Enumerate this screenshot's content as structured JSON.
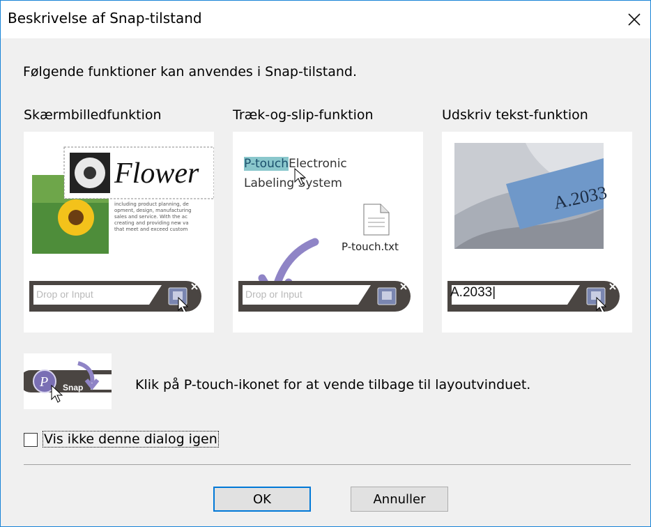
{
  "window": {
    "title": "Beskrivelse af Snap-tilstand",
    "close_icon": "close-icon"
  },
  "intro": "Følgende funktioner kan anvendes i Snap-tilstand.",
  "panels": [
    {
      "title": "Skærmbilledfunktion",
      "image_word": "Flower",
      "bar_text": "Drop or Input"
    },
    {
      "title": "Træk-og-slip-funktion",
      "highlight": "P-touch",
      "line1_rest": "Electronic",
      "line2": "Labeling System",
      "file_name": "P-touch.txt",
      "bar_text": "Drop or Input"
    },
    {
      "title": "Udskriv tekst-funktion",
      "label_text": "A.2033",
      "bar_text": "A.2033|"
    }
  ],
  "ptouch_hint": {
    "badge": "Snap",
    "caption": "Klik på P-touch-ikonet for at vende tilbage til layoutvinduet."
  },
  "checkbox": {
    "label": "Vis ikke denne dialog igen",
    "checked": false
  },
  "buttons": {
    "ok": "OK",
    "cancel": "Annuller"
  },
  "colors": {
    "accent": "#0078d7",
    "highlight": "#8ac7cc",
    "bar": "#4a4542"
  }
}
